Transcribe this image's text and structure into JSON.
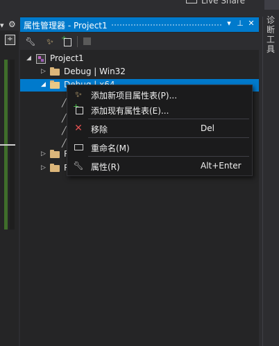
{
  "top": {
    "live_share_label": "Live Share"
  },
  "panel": {
    "title": "属性管理器 - Project1"
  },
  "toolbar": {
    "icons": [
      "wrench-icon",
      "wand-icon",
      "add-sheet-icon",
      "save-icon"
    ]
  },
  "tree": {
    "project": "Project1",
    "config_debug_win32": "Debug | Win32",
    "config_debug_x64": "Debug | x64",
    "config_release_partial_1": "R",
    "config_release_partial_2": "R"
  },
  "right_tab": {
    "label": "诊断工具"
  },
  "context_menu": {
    "items": [
      {
        "label": "添加新项目属性表(P)...",
        "shortcut": "",
        "icon": "wand-icon",
        "icon_color": "#e8c887"
      },
      {
        "label": "添加现有属性表(E)...",
        "shortcut": "",
        "icon": "add-sheet-icon",
        "icon_color": "#4ec94e"
      },
      {
        "label": "移除",
        "shortcut": "Del",
        "icon": "remove-x-icon",
        "icon_color": "#e05050"
      },
      {
        "label": "重命名(M)",
        "shortcut": "",
        "icon": "rename-icon",
        "icon_color": "#d0d0d0"
      },
      {
        "label": "属性(R)",
        "shortcut": "Alt+Enter",
        "icon": "wrench-icon",
        "icon_color": "#d0d0d0"
      }
    ]
  },
  "colors": {
    "accent": "#007acc",
    "panel_bg": "#252526",
    "menu_bg": "#1b1b1c",
    "folder": "#dcb67a"
  }
}
